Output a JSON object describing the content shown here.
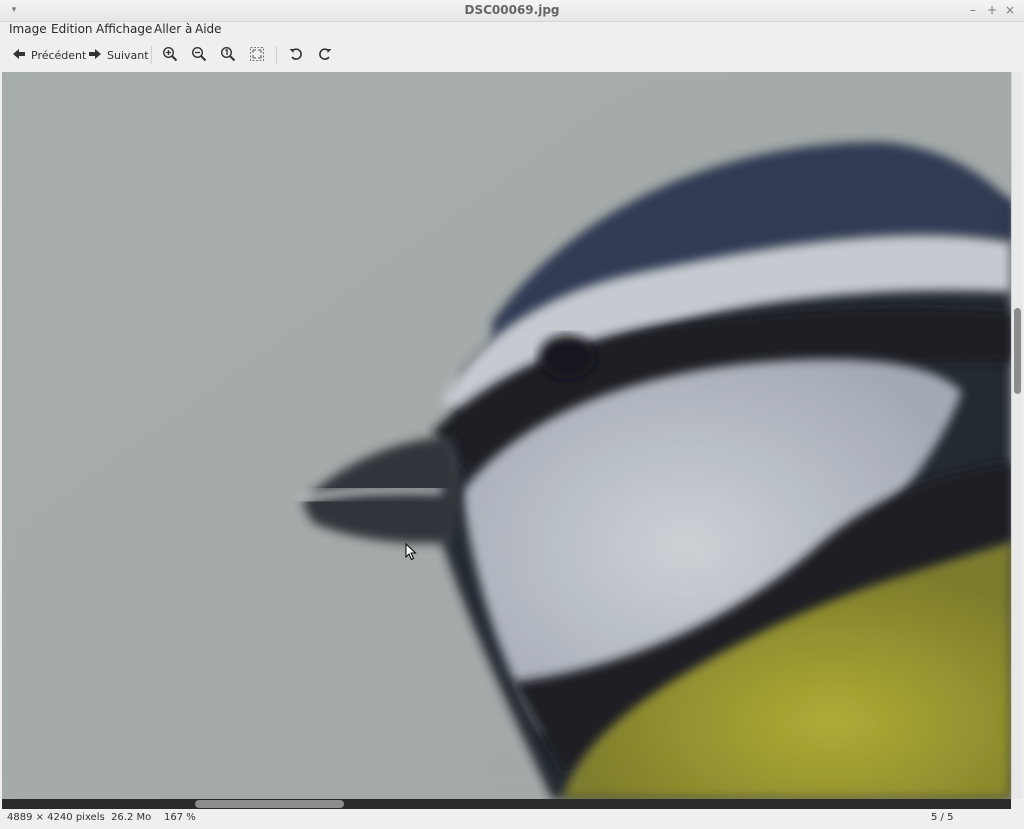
{
  "window": {
    "title": "DSC00069.jpg"
  },
  "menu": {
    "items": [
      {
        "label": "Image"
      },
      {
        "label": "Edition"
      },
      {
        "label": "Affichage"
      },
      {
        "label": "Aller à"
      },
      {
        "label": "Aide"
      }
    ]
  },
  "toolbar": {
    "previous_label": "Précédent",
    "next_label": "Suivant",
    "icons": [
      "arrow-left-icon",
      "arrow-right-icon",
      "zoom-in-icon",
      "zoom-out-icon",
      "zoom-original-icon",
      "zoom-fit-icon",
      "rotate-left-icon",
      "rotate-right-icon"
    ]
  },
  "status": {
    "dimensions": "4889 × 4240 pixels",
    "size": "26.2 Mo",
    "zoom": "167 %",
    "position": "5 / 5"
  },
  "scroll": {
    "vertical_fraction": 0.4,
    "horizontal_fraction": 0.19
  },
  "colors": {
    "background": "#a9aeac",
    "window": "#efefef"
  }
}
